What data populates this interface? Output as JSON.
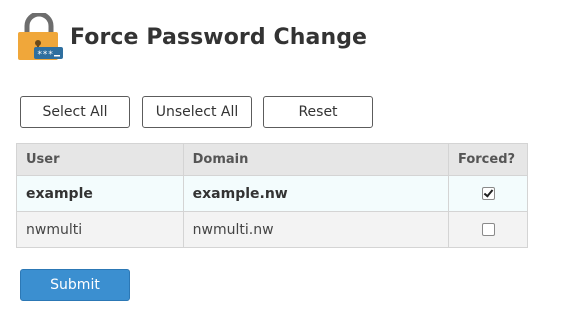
{
  "header": {
    "title": "Force Password Change",
    "icon": "padlock-password-icon"
  },
  "actions": {
    "select_all_label": "Select All",
    "unselect_all_label": "Unselect All",
    "reset_label": "Reset"
  },
  "table": {
    "columns": [
      "User",
      "Domain",
      "Forced?"
    ],
    "rows": [
      {
        "user": "example",
        "domain": "example.nw",
        "forced": true
      },
      {
        "user": "nwmulti",
        "domain": "nwmulti.nw",
        "forced": false
      }
    ]
  },
  "lock_icon_text": "***",
  "submit_label": "Submit",
  "colors": {
    "accent": "#3b8fd0",
    "lock_body": "#f0a73a",
    "lock_shackle": "#6d6d6d",
    "badge": "#2f6f9f",
    "highlight_row": "#f3fcfd"
  }
}
